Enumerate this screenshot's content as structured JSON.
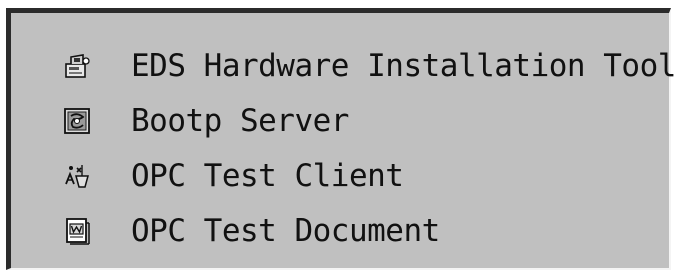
{
  "menu": {
    "items": [
      {
        "label": "EDS Hardware Installation Tool",
        "icon": "hardware-install-icon"
      },
      {
        "label": "Bootp Server",
        "icon": "bootp-server-icon"
      },
      {
        "label": "OPC Test Client",
        "icon": "opc-test-client-icon"
      },
      {
        "label": "OPC Test Document",
        "icon": "word-document-icon"
      }
    ]
  },
  "colors": {
    "panel_background": "#c0c0c0",
    "border_dark": "#2b2b2b",
    "border_light": "#f4f4f4",
    "text": "#111111"
  }
}
